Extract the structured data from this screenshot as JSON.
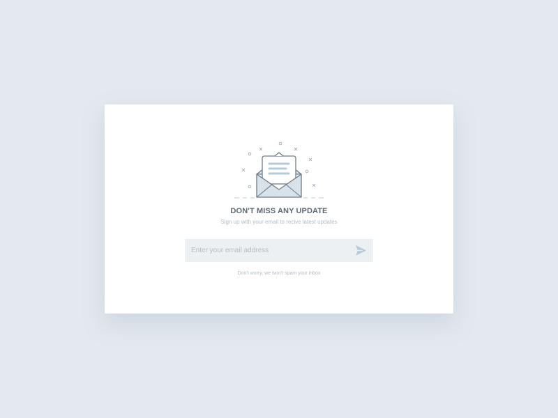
{
  "colors": {
    "background": "#e3e9ef",
    "card": "#ffffff",
    "title": "#5f6872",
    "muted_text": "#b3bcc4",
    "input_background": "#edf0f2",
    "accent": "#b7cbd7",
    "icon_stroke": "#6f7c86"
  },
  "icons": {
    "illustration": "open-envelope-icon",
    "send": "paper-plane-icon"
  },
  "newsletter": {
    "title": "DON'T MISS ANY UPDATE",
    "subtitle": "Sign up with your email to recive latest updates",
    "email": {
      "value": "",
      "placeholder": "Enter your email address"
    },
    "note": "Don't worry, we won't spam your inbox"
  }
}
